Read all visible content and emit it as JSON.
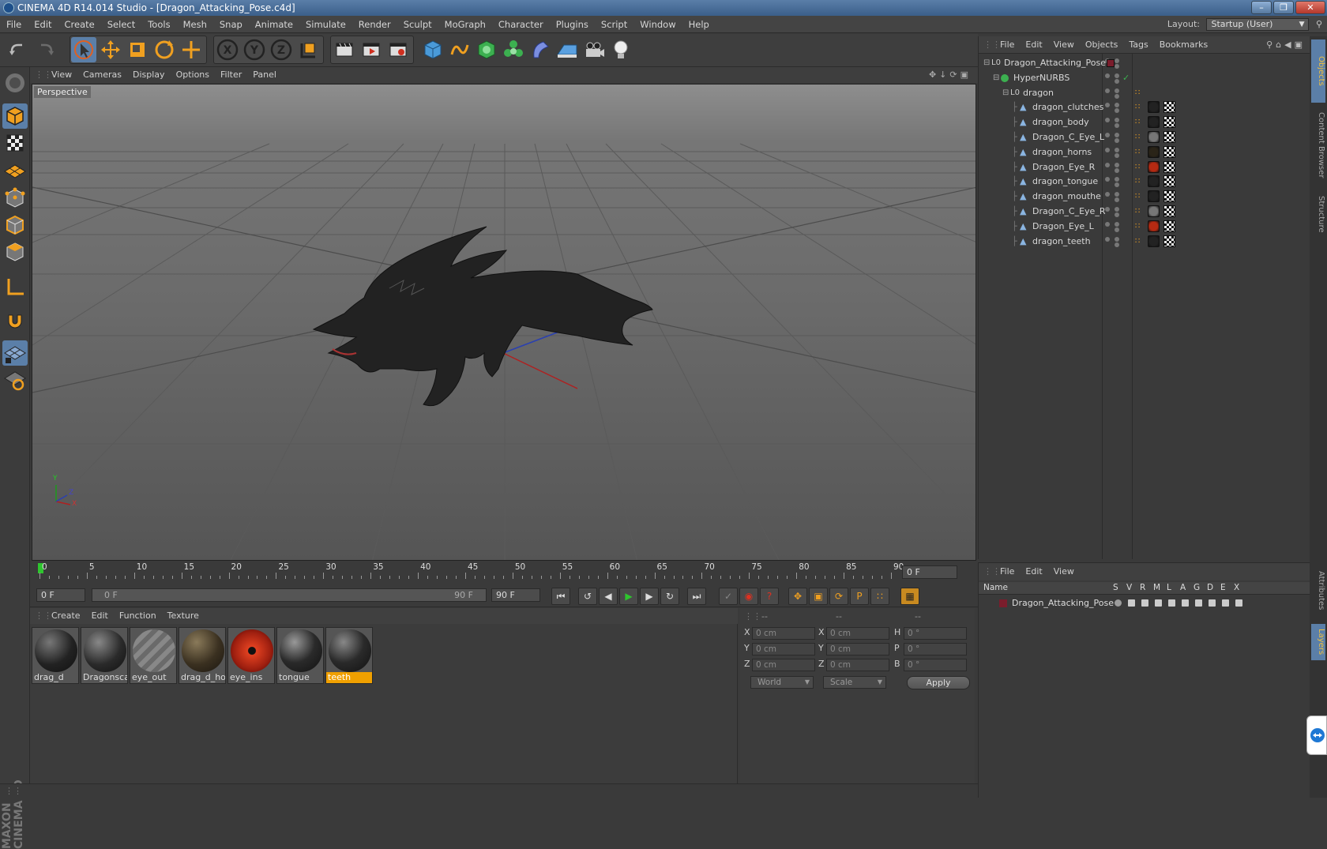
{
  "window": {
    "title": "CINEMA 4D R14.014 Studio - [Dragon_Attacking_Pose.c4d]"
  },
  "menubar": {
    "items": [
      "File",
      "Edit",
      "Create",
      "Select",
      "Tools",
      "Mesh",
      "Snap",
      "Animate",
      "Simulate",
      "Render",
      "Sculpt",
      "MoGraph",
      "Character",
      "Plugins",
      "Script",
      "Window",
      "Help"
    ],
    "layout_label": "Layout:",
    "layout_value": "Startup (User)"
  },
  "viewport": {
    "menu": [
      "View",
      "Cameras",
      "Display",
      "Options",
      "Filter",
      "Panel"
    ],
    "label": "Perspective",
    "axis_y": "Y",
    "axis_z": "Z",
    "axis_x": "X"
  },
  "timeline": {
    "ticks": [
      "0",
      "5",
      "10",
      "15",
      "20",
      "25",
      "30",
      "35",
      "40",
      "45",
      "50",
      "55",
      "60",
      "65",
      "70",
      "75",
      "80",
      "85",
      "90"
    ],
    "current_frame_field": "0 F",
    "start_field": "0 F",
    "range_start": "0 F",
    "range_end": "90 F",
    "end_field": "90 F"
  },
  "materials": {
    "menu": [
      "Create",
      "Edit",
      "Function",
      "Texture"
    ],
    "items": [
      {
        "label": "drag_d",
        "selected": false
      },
      {
        "label": "Dragonsca",
        "selected": false
      },
      {
        "label": "eye_out",
        "selected": false
      },
      {
        "label": "drag_d_ho",
        "selected": false
      },
      {
        "label": "eye_ins",
        "selected": false
      },
      {
        "label": "tongue",
        "selected": false
      },
      {
        "label": "teeth",
        "selected": true
      }
    ]
  },
  "coordinates": {
    "headers": [
      "--",
      "--",
      "--"
    ],
    "rows": [
      {
        "a": "X",
        "av": "0 cm",
        "b": "X",
        "bv": "0 cm",
        "c": "H",
        "cv": "0 °"
      },
      {
        "a": "Y",
        "av": "0 cm",
        "b": "Y",
        "bv": "0 cm",
        "c": "P",
        "cv": "0 °"
      },
      {
        "a": "Z",
        "av": "0 cm",
        "b": "Z",
        "bv": "0 cm",
        "c": "B",
        "cv": "0 °"
      }
    ],
    "world": "World",
    "scale": "Scale",
    "apply": "Apply"
  },
  "objects": {
    "menu": [
      "File",
      "Edit",
      "View",
      "Objects",
      "Tags",
      "Bookmarks"
    ],
    "rows": [
      {
        "name": "Dragon_Attacking_Pose",
        "level": 0,
        "type": "null"
      },
      {
        "name": "HyperNURBS",
        "level": 1,
        "type": "nurbs"
      },
      {
        "name": "dragon",
        "level": 2,
        "type": "null"
      },
      {
        "name": "dragon_clutches",
        "level": 3,
        "type": "poly",
        "tag": "#222"
      },
      {
        "name": "dragon_body",
        "level": 3,
        "type": "poly",
        "tag": "#222"
      },
      {
        "name": "Dragon_C_Eye_L",
        "level": 3,
        "type": "poly",
        "tag": "#777"
      },
      {
        "name": "dragon_horns",
        "level": 3,
        "type": "poly",
        "tag": "#2a2418"
      },
      {
        "name": "Dragon_Eye_R",
        "level": 3,
        "type": "poly",
        "tag": "#b52a12"
      },
      {
        "name": "dragon_tongue",
        "level": 3,
        "type": "poly",
        "tag": "#222"
      },
      {
        "name": "dragon_mouthe",
        "level": 3,
        "type": "poly",
        "tag": "#222"
      },
      {
        "name": "Dragon_C_Eye_R",
        "level": 3,
        "type": "poly",
        "tag": "#777"
      },
      {
        "name": "Dragon_Eye_L",
        "level": 3,
        "type": "poly",
        "tag": "#b52a12"
      },
      {
        "name": "dragon_teeth",
        "level": 3,
        "type": "poly",
        "tag": "#222"
      }
    ]
  },
  "layers": {
    "menu": [
      "File",
      "Edit",
      "View"
    ],
    "columns": [
      "Name",
      "S",
      "V",
      "R",
      "M",
      "L",
      "A",
      "G",
      "D",
      "E",
      "X"
    ],
    "rows": [
      {
        "name": "Dragon_Attacking_Pose",
        "color": "#7a1d2c"
      }
    ]
  },
  "right_tabs": [
    "Objects",
    "Content Browser",
    "Structure",
    "Attributes",
    "Layers"
  ],
  "branding": "MAXON CINEMA 4D",
  "colors": {
    "accent": "#5b7fa8",
    "selected_material": "#f0a000"
  }
}
